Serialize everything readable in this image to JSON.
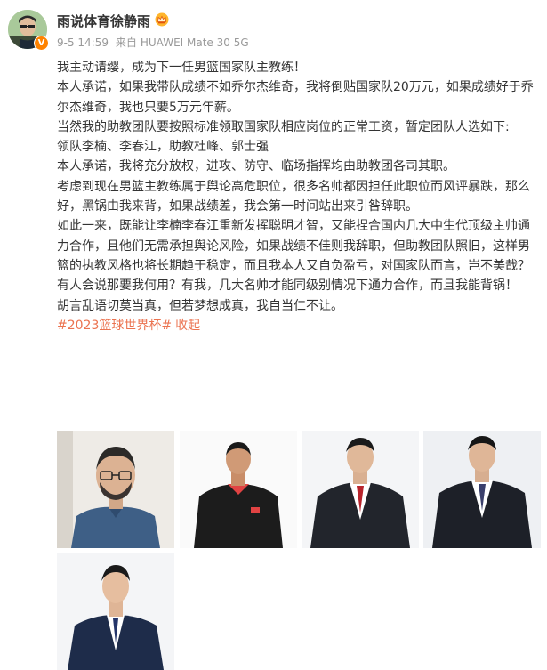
{
  "user": {
    "name": "雨说体育徐静雨",
    "timestamp": "9-5 14:59",
    "source_prefix": "来自",
    "device": "HUAWEI Mate 30 5G"
  },
  "post": {
    "paragraphs": [
      "我主动请缨，成为下一任男篮国家队主教练！",
      "本人承诺，如果我带队成绩不如乔尔杰维奇，我将倒贴国家队20万元，如果成绩好于乔尔杰维奇，我也只要5万元年薪。",
      "当然我的助教团队要按照标准领取国家队相应岗位的正常工资，暂定团队人选如下:",
      "领队李楠、李春江，助教杜峰、郭士强",
      "本人承诺，我将充分放权，进攻、防守、临场指挥均由助教团各司其职。",
      "考虑到现在男篮主教练属于舆论高危职位，很多名帅都因担任此职位而风评暴跌，那么好，黑锅由我来背，如果战绩差，我会第一时间站出来引咎辞职。",
      "如此一来，既能让李楠李春江重新发挥聪明才智，又能捏合国内几大中生代顶级主帅通力合作，且他们无需承担舆论风险，如果战绩不佳则我辞职，但助教团队照旧，这样男篮的执教风格也将长期趋于稳定，而且我本人又自负盈亏，对国家队而言，岂不美哉？",
      "有人会说那要我何用？有我，几大名帅才能同级别情况下通力合作，而且我能背锅！",
      "胡言乱语切莫当真，但若梦想成真，我自当仁不让。"
    ],
    "hashtag": "#2023篮球世界杯#",
    "collapse": "收起"
  },
  "icons": {
    "verified": "verified-badge-icon",
    "crown": "vip-crown-icon"
  },
  "colors": {
    "link": "#eb7350",
    "meta": "#999999",
    "badge": "#ff8200"
  }
}
